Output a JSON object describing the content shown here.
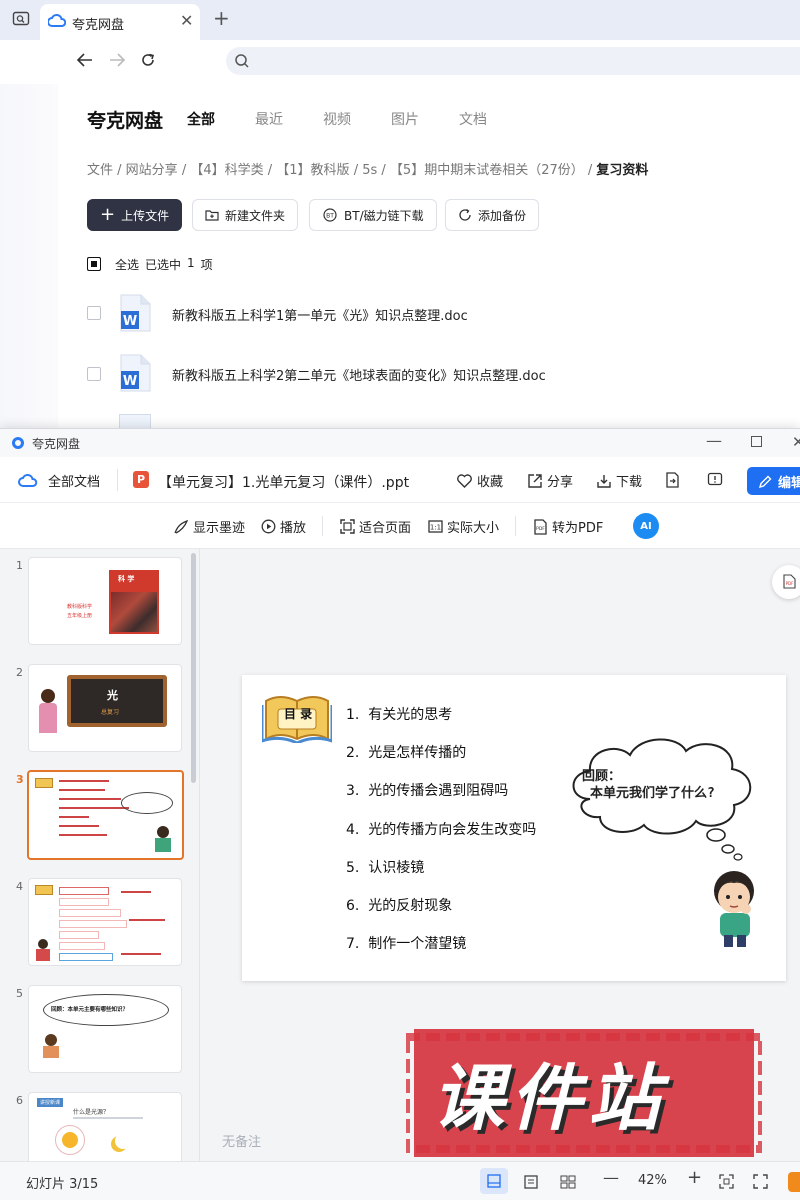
{
  "browser": {
    "tab_title": "夸克网盘",
    "search_placeholder": ""
  },
  "netdisk": {
    "logo": "夸克网盘",
    "tabs": [
      {
        "label": "全部",
        "active": true
      },
      {
        "label": "最近"
      },
      {
        "label": "视频"
      },
      {
        "label": "图片"
      },
      {
        "label": "文档"
      }
    ],
    "breadcrumb": [
      "文件",
      "网站分享",
      "【4】科学类",
      "【1】教科版",
      "5s",
      "【5】期中期末试卷相关（27份）",
      "复习资料"
    ],
    "buttons": {
      "upload": "上传文件",
      "new_folder": "新建文件夹",
      "bt": "BT/磁力链下载",
      "backup": "添加备份"
    },
    "select_all": "全选",
    "selected": "已选中",
    "selected_count": "1",
    "selected_unit": "项",
    "files": [
      {
        "name": "新教科版五上科学1第一单元《光》知识点整理.doc"
      },
      {
        "name": "新教科版五上科学2第二单元《地球表面的变化》知识点整理.doc"
      }
    ]
  },
  "viewer": {
    "window_title": "夸克网盘",
    "all_docs": "全部文档",
    "file_title": "【单元复习】1.光单元复习（课件）.ppt",
    "collect": "收藏",
    "share": "分享",
    "download": "下载",
    "edit": "编辑",
    "tools": {
      "ink": "显示墨迹",
      "play": "播放",
      "fit": "适合页面",
      "actual": "实际大小",
      "to_pdf": "转为PDF",
      "ai": "AI"
    },
    "thumbs": [
      "1",
      "2",
      "3",
      "4",
      "5",
      "6"
    ],
    "thumb_text": {
      "t1_title": "科 学",
      "t1_sub1": "教科版科学",
      "t1_sub2": "五年级上册",
      "t2_title": "光",
      "t2_sub": "总复习",
      "t5_text": "回顾：本单元主要有哪些知识？",
      "t6_tag": "讲授新课",
      "t6_title": "什么是光源？"
    },
    "selected_thumb": 3,
    "slide": {
      "toc_label": "目 录",
      "items": [
        {
          "num": "1.",
          "text": "有关光的思考"
        },
        {
          "num": "2.",
          "text": "光是怎样传播的"
        },
        {
          "num": "3.",
          "text": "光的传播会遇到阻碍吗"
        },
        {
          "num": "4.",
          "text": "光的传播方向会发生改变吗"
        },
        {
          "num": "5.",
          "text": "认识棱镜"
        },
        {
          "num": "6.",
          "text": "光的反射现象"
        },
        {
          "num": "7.",
          "text": "制作一个潜望镜"
        }
      ],
      "cloud_line1": "回顾：",
      "cloud_line2": "本单元我们学了什么?"
    },
    "notes": "无备注",
    "watermark": "课件站",
    "status_slide": "幻灯片 3/15",
    "zoom": "42%"
  },
  "colors": {
    "accent_blue": "#1f6ff2",
    "primary_dark": "#2f3343",
    "selection_orange": "#e3742a",
    "watermark_red": "#d6343f"
  }
}
